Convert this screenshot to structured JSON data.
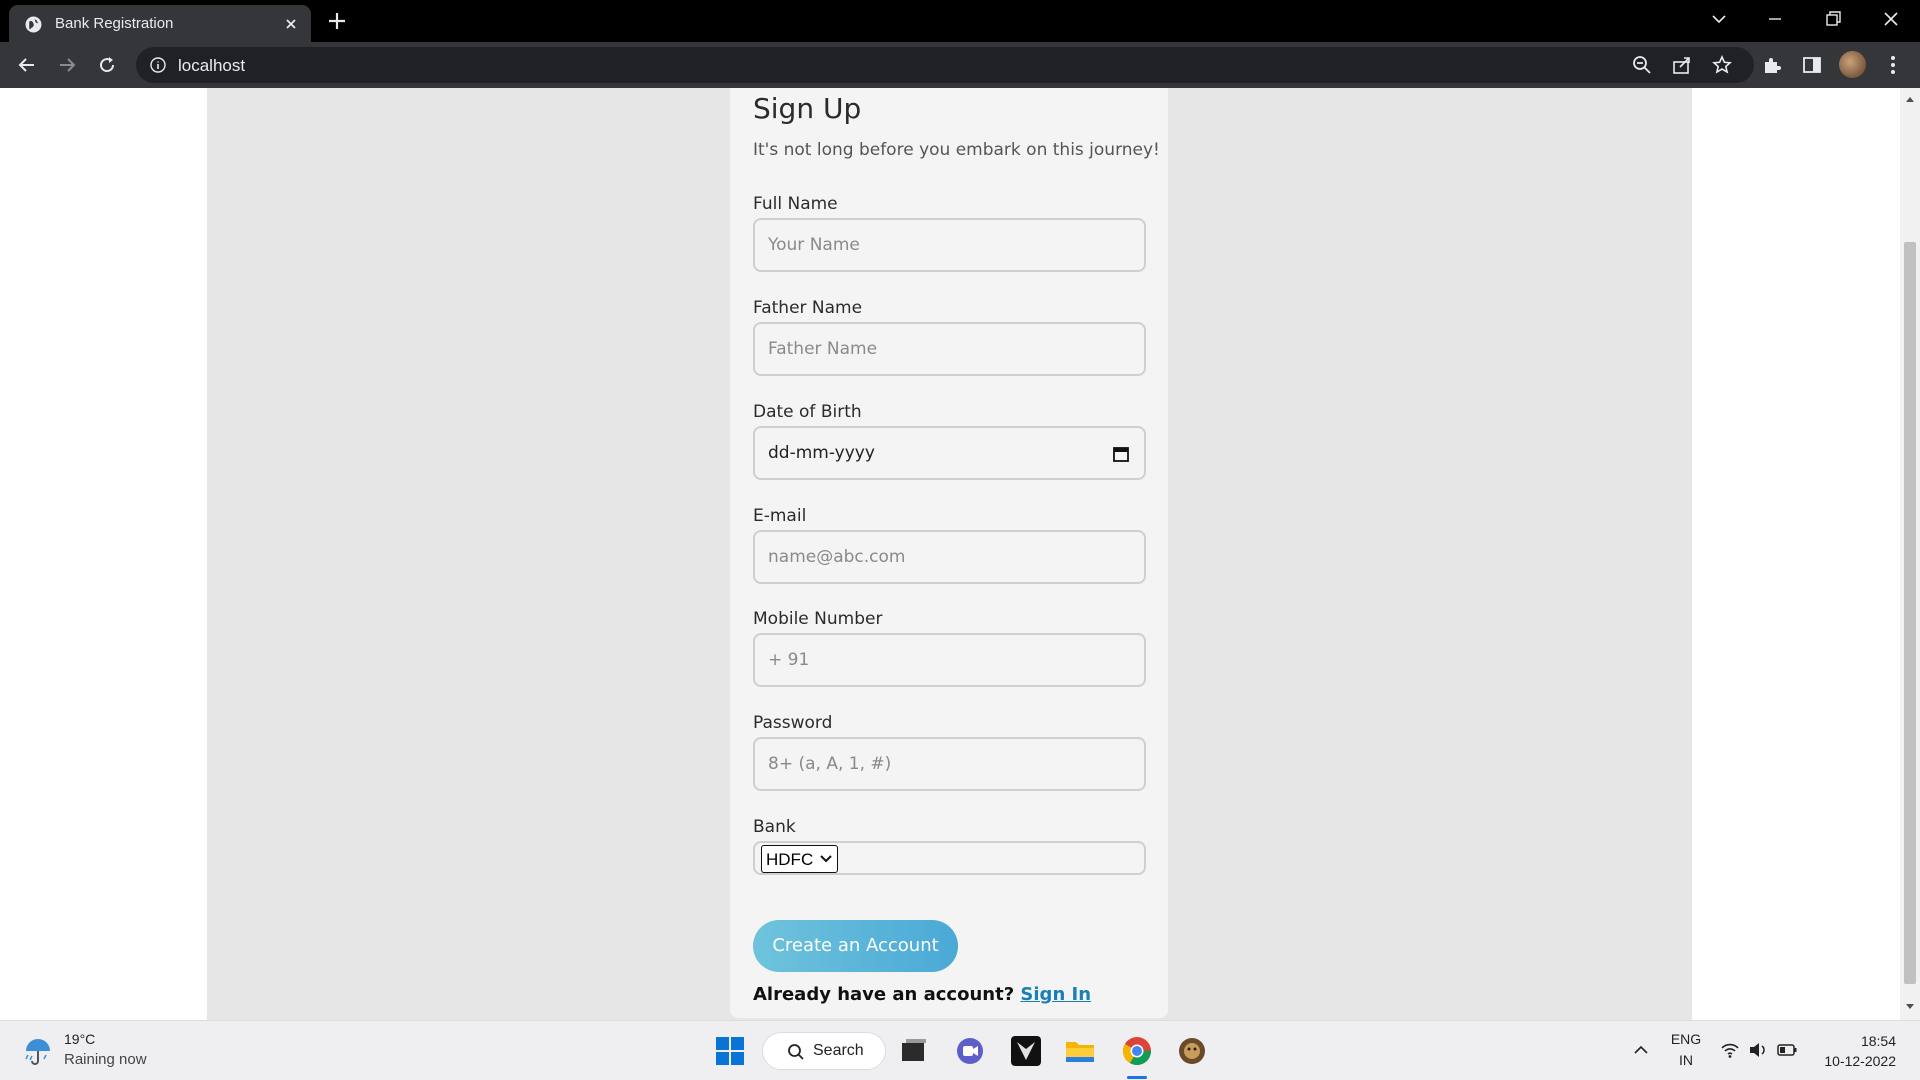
{
  "browser": {
    "tab_title": "Bank Registration",
    "url": "localhost"
  },
  "form": {
    "title": "Sign Up",
    "subtitle": "It's not long before you embark on this journey!",
    "fields": [
      {
        "label": "Full Name",
        "placeholder": "Your Name"
      },
      {
        "label": "Father Name",
        "placeholder": "Father Name"
      },
      {
        "label": "Date of Birth",
        "value": "dd-mm-yyyy"
      },
      {
        "label": "E-mail",
        "placeholder": "name@abc.com"
      },
      {
        "label": "Mobile Number",
        "placeholder": "+ 91"
      },
      {
        "label": "Password",
        "placeholder": "8+ (a, A, 1, #)"
      }
    ],
    "bank": {
      "label": "Bank",
      "selected": "HDFC"
    },
    "submit_label": "Create an Account",
    "signin_prompt": "Already have an account?",
    "signin_link": "Sign In"
  },
  "taskbar": {
    "weather_temp": "19°C",
    "weather_desc": "Raining now",
    "search_label": "Search",
    "lang_primary": "ENG",
    "lang_secondary": "IN",
    "time": "18:54",
    "date": "10-12-2022"
  },
  "colors": {
    "accent": "#4aa9d6",
    "link": "#1a7fb5"
  }
}
